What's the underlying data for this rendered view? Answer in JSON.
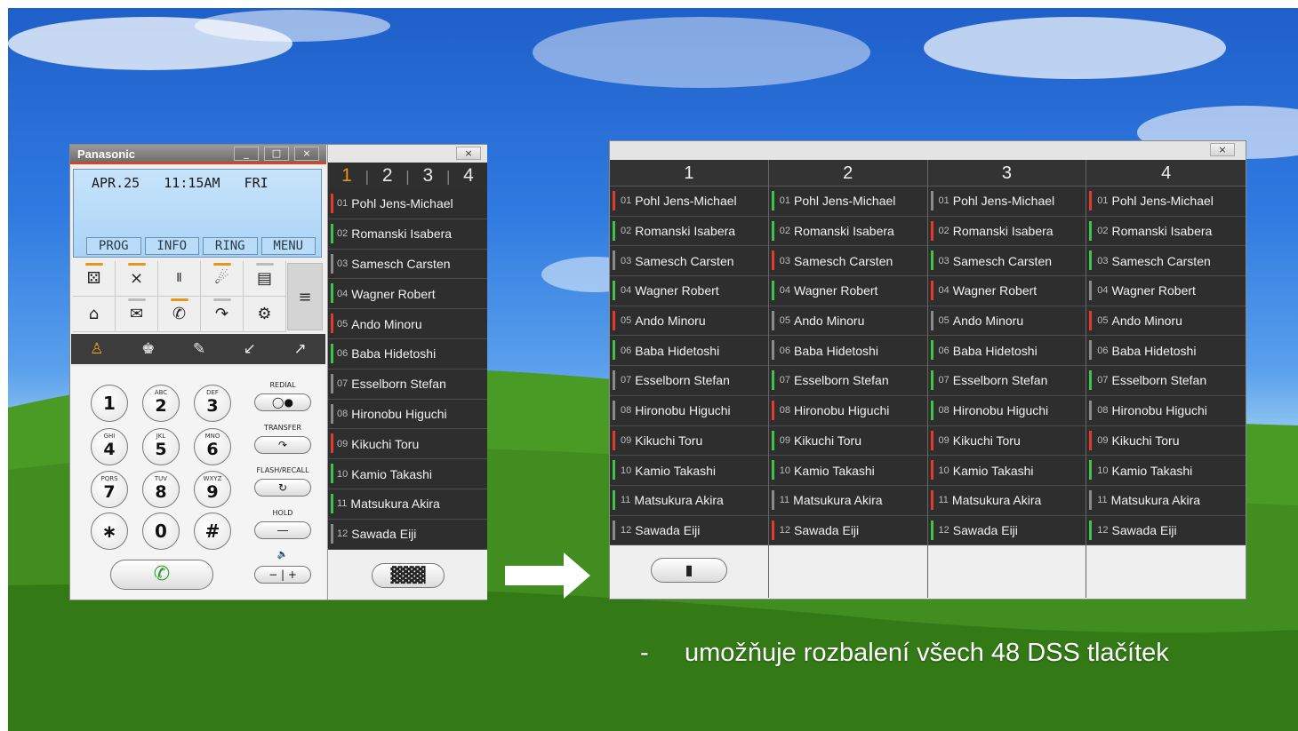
{
  "colors": {
    "red": "#e23a2f",
    "green": "#3fc34a",
    "grey": "#8a8a8a",
    "accent": "#e8951e"
  },
  "phone": {
    "brand": "Panasonic",
    "window_buttons": [
      "_",
      "□",
      "×"
    ],
    "lcd": {
      "date": "APR.25",
      "time": "11:15AM",
      "day": "FRI"
    },
    "softkeys": [
      "PROG",
      "INFO",
      "RING",
      "MENU"
    ],
    "feature_icons": [
      "group-icon",
      "no-disturb-icon",
      "123-icon",
      "speaker-volume-icon",
      "memo-icon",
      "home-icon",
      "mail-icon",
      "phone-call-icon",
      "call-forward-icon",
      "settings-icon"
    ],
    "nav_icons": [
      "contact-active-icon",
      "contacts-group-icon",
      "edit-icon",
      "call-in-icon",
      "call-out-icon"
    ],
    "dialpad": [
      {
        "num": "1",
        "sub": ""
      },
      {
        "num": "2",
        "sub": "ABC"
      },
      {
        "num": "3",
        "sub": "DEF"
      },
      {
        "num": "4",
        "sub": "GHI"
      },
      {
        "num": "5",
        "sub": "JKL"
      },
      {
        "num": "6",
        "sub": "MNO"
      },
      {
        "num": "7",
        "sub": "PQRS"
      },
      {
        "num": "8",
        "sub": "TUV"
      },
      {
        "num": "9",
        "sub": "WXYZ"
      },
      {
        "num": "∗",
        "sub": ""
      },
      {
        "num": "0",
        "sub": ""
      },
      {
        "num": "#",
        "sub": ""
      }
    ],
    "function_keys": [
      "REDIAL",
      "TRANSFER",
      "FLASH/RECALL",
      "HOLD"
    ],
    "volume": {
      "minus": "−",
      "plus": "+"
    }
  },
  "dss_small": {
    "close": "×",
    "pages": [
      "1",
      "2",
      "3",
      "4"
    ],
    "active_page": "1",
    "entries": [
      {
        "idx": "01",
        "name": "Pohl Jens-Michael",
        "status": "red"
      },
      {
        "idx": "02",
        "name": "Romanski Isabera",
        "status": "green"
      },
      {
        "idx": "03",
        "name": "Samesch Carsten",
        "status": "grey"
      },
      {
        "idx": "04",
        "name": "Wagner Robert",
        "status": "green"
      },
      {
        "idx": "05",
        "name": "Ando Minoru",
        "status": "red"
      },
      {
        "idx": "06",
        "name": "Baba Hidetoshi",
        "status": "green"
      },
      {
        "idx": "07",
        "name": "Esselborn Stefan",
        "status": "grey"
      },
      {
        "idx": "08",
        "name": "Hironobu Higuchi",
        "status": "grey"
      },
      {
        "idx": "09",
        "name": "Kikuchi Toru",
        "status": "red"
      },
      {
        "idx": "10",
        "name": "Kamio Takashi",
        "status": "green"
      },
      {
        "idx": "11",
        "name": "Matsukura Akira",
        "status": "green"
      },
      {
        "idx": "12",
        "name": "Sawada Eiji",
        "status": "grey"
      }
    ]
  },
  "dss_large": {
    "close": "×",
    "columns": [
      {
        "header": "1",
        "statuses": [
          "red",
          "green",
          "grey",
          "green",
          "red",
          "green",
          "grey",
          "grey",
          "red",
          "green",
          "green",
          "grey"
        ]
      },
      {
        "header": "2",
        "statuses": [
          "green",
          "green",
          "red",
          "green",
          "grey",
          "grey",
          "green",
          "red",
          "green",
          "green",
          "grey",
          "red"
        ]
      },
      {
        "header": "3",
        "statuses": [
          "grey",
          "red",
          "green",
          "red",
          "grey",
          "green",
          "green",
          "green",
          "red",
          "red",
          "red",
          "green"
        ]
      },
      {
        "header": "4",
        "statuses": [
          "red",
          "green",
          "green",
          "grey",
          "red",
          "grey",
          "green",
          "grey",
          "red",
          "green",
          "grey",
          "green"
        ]
      }
    ],
    "names": [
      "Pohl Jens-Michael",
      "Romanski Isabera",
      "Samesch Carsten",
      "Wagner Robert",
      "Ando Minoru",
      "Baba Hidetoshi",
      "Esselborn Stefan",
      "Hironobu Higuchi",
      "Kikuchi Toru",
      "Kamio Takashi",
      "Matsukura Akira",
      "Sawada Eiji"
    ],
    "idx": [
      "01",
      "02",
      "03",
      "04",
      "05",
      "06",
      "07",
      "08",
      "09",
      "10",
      "11",
      "12"
    ]
  },
  "caption": "-     umožňuje rozbalení všech 48 DSS tlačítek"
}
